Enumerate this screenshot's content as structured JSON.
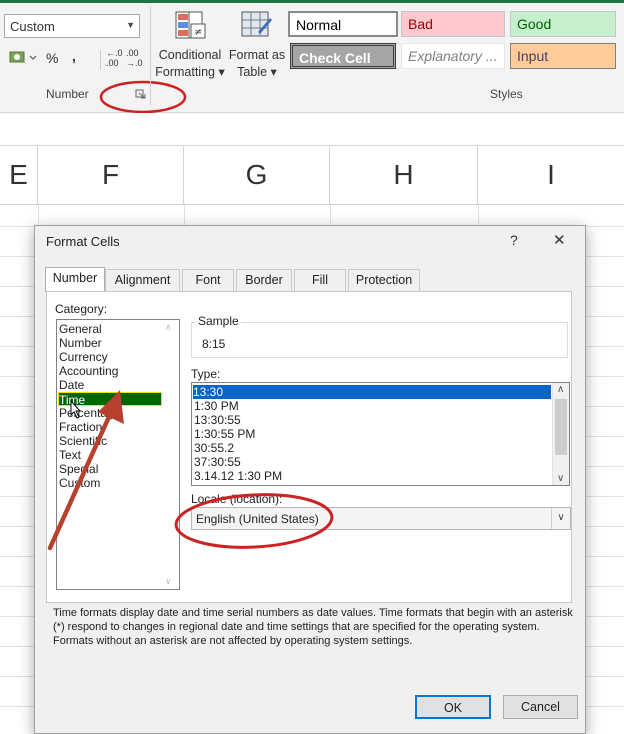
{
  "ribbon": {
    "number_format_value": "Custom",
    "currency_glyph": "$",
    "percent_glyph": "%",
    "comma_glyph": ",",
    "increase_decimal": "←.0 .00",
    "decrease_decimal": ".00 →.0",
    "conditional_formatting": [
      "Conditional",
      "Formatting ▾"
    ],
    "format_as_table": [
      "Format as",
      "Table ▾"
    ],
    "number_group_label": "Number",
    "styles_group_label": "Styles",
    "styles": [
      {
        "label": "Normal",
        "bg": "#ffffff",
        "fg": "#000000"
      },
      {
        "label": "Bad",
        "bg": "#ffc7ce",
        "fg": "#9c0006"
      },
      {
        "label": "Good",
        "bg": "#c6efce",
        "fg": "#006100"
      },
      {
        "label": "Check Cell",
        "bg": "#a5a5a5",
        "fg": "#ffffff"
      },
      {
        "label": "Explanatory ...",
        "bg": "#ffffff",
        "fg": "#7f7f7f"
      },
      {
        "label": "Input",
        "bg": "#ffcc99",
        "fg": "#3f3f76"
      }
    ]
  },
  "sheet": {
    "columns": [
      "E",
      "F",
      "G",
      "H",
      "I"
    ]
  },
  "dialog": {
    "title": "Format Cells",
    "help_glyph": "?",
    "close_glyph": "✕",
    "tabs": [
      "Number",
      "Alignment",
      "Font",
      "Border",
      "Fill",
      "Protection"
    ],
    "active_tab": "Number",
    "category_label": "Category:",
    "categories": [
      "General",
      "Number",
      "Currency",
      "Accounting",
      "Date",
      "Time",
      "Percentage",
      "Fraction",
      "Scientific",
      "Text",
      "Special",
      "Custom"
    ],
    "selected_category": "Time",
    "sample_label": "Sample",
    "sample_value": "8:15",
    "type_label": "Type:",
    "types": [
      "13:30",
      "1:30 PM",
      "13:30:55",
      "1:30:55 PM",
      "30:55.2",
      "37:30:55",
      "3.14.12 1:30 PM"
    ],
    "selected_type": "13:30",
    "locale_label": "Locale (location):",
    "locale_value": "English (United States)",
    "description": "Time formats display date and time serial numbers as date values.  Time formats that begin with an asterisk (*) respond to changes in regional date and time settings that are specified for the operating system. Formats without an asterisk are not affected by operating system settings.",
    "ok_label": "OK",
    "cancel_label": "Cancel"
  },
  "annotations": {
    "highlight_color": "#cc2222",
    "arrow_color": "#b8402e"
  }
}
